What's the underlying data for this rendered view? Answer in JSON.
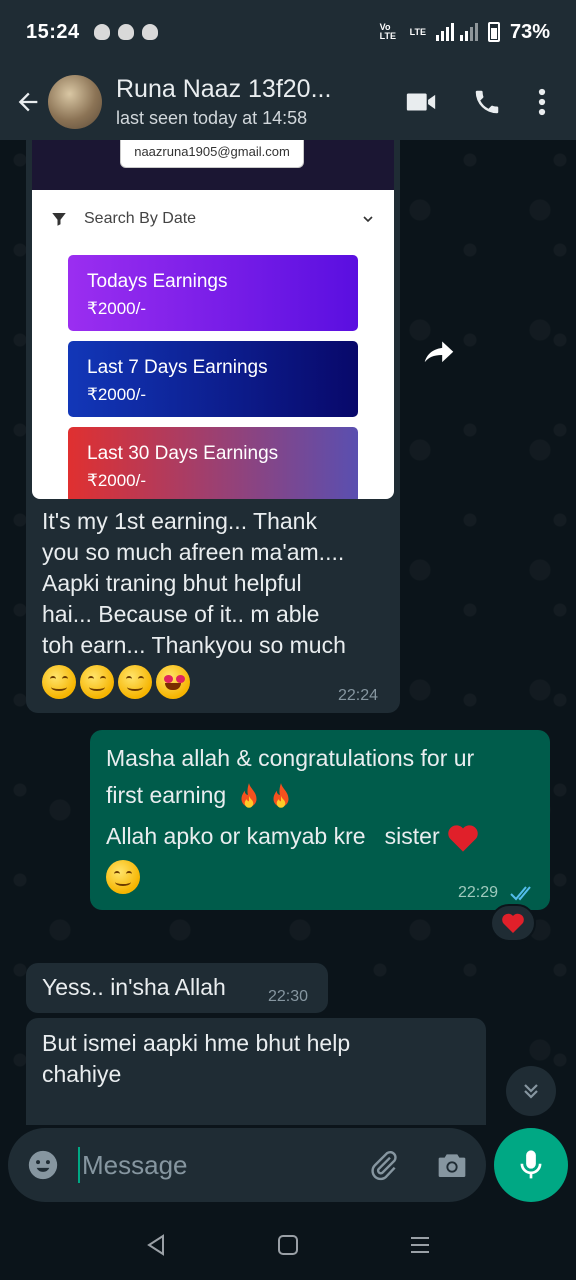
{
  "status_bar": {
    "time": "15:24",
    "network_tag_1": "Vo LTE",
    "network_tag_2": "LTE",
    "battery": "73%"
  },
  "header": {
    "contact_name": "Runa Naaz 13f20...",
    "last_seen": "last seen today at 14:58",
    "icons": [
      "back-arrow-icon",
      "video-call-icon",
      "phone-icon",
      "more-vert-icon"
    ]
  },
  "messages": {
    "image_message": {
      "screenshot": {
        "email": "naazruna1905@gmail.com",
        "filter_label": "Search By Date",
        "cards": [
          {
            "title": "Todays Earnings",
            "value": "₹2000/-",
            "color_from": "#9b2ef0",
            "color_to": "#5a0fe0"
          },
          {
            "title": "Last 7 Days Earnings",
            "value": "₹2000/-",
            "color_from": "#1237b8",
            "color_to": "#08086a"
          },
          {
            "title": "Last 30 Days Earnings",
            "value": "₹2000/-",
            "color_from": "#e03030",
            "color_to": "#5a4fb0"
          }
        ]
      },
      "caption_lines": [
        "It's my 1st earning... Thank",
        "you so much afreen ma'am....",
        "Aapki traning bhut helpful",
        "hai... Because of it.. m able",
        "toh earn... Thankyou so much"
      ],
      "time": "22:24"
    },
    "outgoing": {
      "line1": "Masha allah & congratulations for ur",
      "line2": "first earning",
      "line3": "Allah apko or kamyab kre   sister",
      "time": "22:29",
      "ticks": "read"
    },
    "incoming_1": {
      "text": "Yess.. in'sha Allah",
      "time": "22:30"
    },
    "incoming_2": {
      "line1": "But ismei aapki hme bhut help",
      "line2": "chahiye"
    }
  },
  "input": {
    "placeholder": "Message"
  },
  "colors": {
    "chat_bg": "#0b141a",
    "incoming_bubble": "#1f2c34",
    "outgoing_bubble": "#005c4b",
    "accent": "#00a884",
    "read_ticks": "#53bdeb"
  }
}
